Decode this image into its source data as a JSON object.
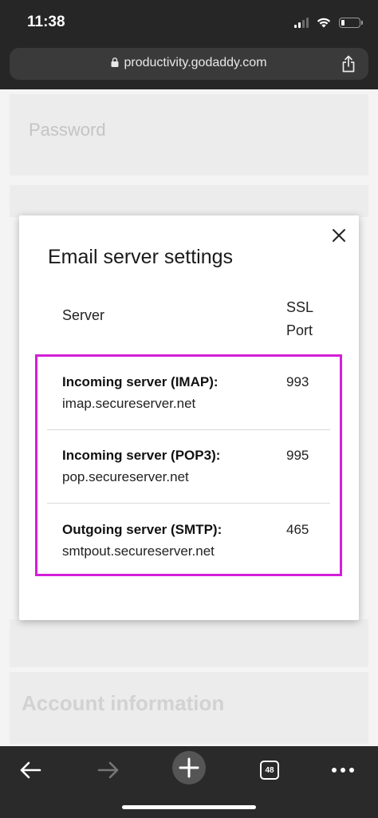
{
  "status_bar": {
    "time": "11:38"
  },
  "browser": {
    "url": "productivity.godaddy.com",
    "tab_count": "48"
  },
  "page": {
    "password_placeholder": "Password",
    "account_section_title": "Account information"
  },
  "modal": {
    "title": "Email server settings",
    "column_server": "Server",
    "column_ssl_line1": "SSL",
    "column_ssl_line2": "Port",
    "rows": [
      {
        "name": "Incoming server (IMAP):",
        "host": "imap.secureserver.net",
        "port": "993"
      },
      {
        "name": "Incoming server (POP3):",
        "host": "pop.secureserver.net",
        "port": "995"
      },
      {
        "name": "Outgoing server (SMTP):",
        "host": "smtpout.secureserver.net",
        "port": "465"
      }
    ]
  },
  "colors": {
    "highlight_border": "#d41ed8",
    "chrome_background": "#262626"
  }
}
